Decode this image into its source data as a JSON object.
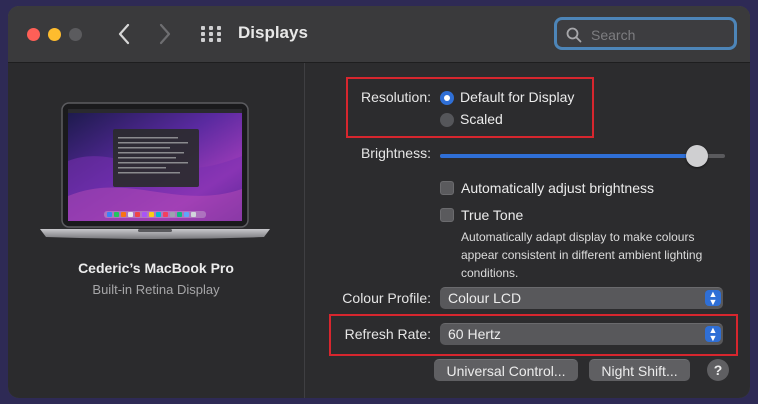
{
  "window": {
    "title": "Displays",
    "search": {
      "placeholder": "Search"
    }
  },
  "device": {
    "name": "Cederic’s MacBook Pro",
    "subtitle": "Built-in Retina Display"
  },
  "settings": {
    "resolution": {
      "label": "Resolution:",
      "options": [
        {
          "label": "Default for Display",
          "selected": true
        },
        {
          "label": "Scaled",
          "selected": false
        }
      ]
    },
    "brightness": {
      "label": "Brightness:",
      "level": 0.9
    },
    "auto_brightness": {
      "label": "Automatically adjust brightness",
      "checked": false
    },
    "true_tone": {
      "label": "True Tone",
      "checked": false,
      "description": "Automatically adapt display to make colours appear consistent in different ambient lighting conditions."
    },
    "colour_profile": {
      "label": "Colour Profile:",
      "value": "Colour LCD"
    },
    "refresh_rate": {
      "label": "Refresh Rate:",
      "value": "60 Hertz"
    }
  },
  "buttons": {
    "universal_control": "Universal Control...",
    "night_shift": "Night Shift...",
    "help": "?"
  },
  "colors": {
    "accent": "#2f6fd6",
    "highlight": "#d7262e",
    "window_bg": "#2c2c2e"
  },
  "icons": [
    "back-chevron-icon",
    "forward-chevron-icon",
    "grid-icon",
    "search-icon",
    "laptop-icon",
    "popup-stepper-icon"
  ]
}
